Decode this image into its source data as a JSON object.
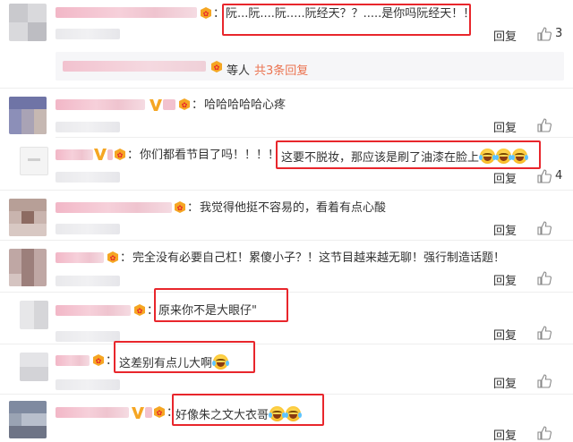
{
  "comments": [
    {
      "text": "阮...阮....阮.....阮经天？？.....是你吗阮经天！！",
      "reply": "回复",
      "likes": "3"
    },
    {
      "text": "哈哈哈哈哈心疼",
      "reply": "回复",
      "likes": ""
    },
    {
      "text_prefix": "你们都看节目了吗！！！！",
      "text_highlight": "这要不脱妆，那应该是刷了油漆在脸上",
      "reply": "回复",
      "likes": "4"
    },
    {
      "text": "我觉得他挺不容易的，看着有点心酸",
      "reply": "回复",
      "likes": ""
    },
    {
      "text": "完全没有必要自己杠！累傻小子？！这节目越来越无聊！强行制造话题！",
      "reply": "回复",
      "likes": ""
    },
    {
      "text": "原来你不是大眼仔\"",
      "reply": "回复",
      "likes": ""
    },
    {
      "text": "这差别有点儿大啊",
      "reply": "回复",
      "likes": ""
    },
    {
      "text": "好像朱之文大衣哥",
      "reply": "回复",
      "likes": ""
    }
  ],
  "summary": {
    "prefix": "等人",
    "link": "共3条回复"
  },
  "colon": "：",
  "colors": {
    "highlight_box": "#e8262c",
    "link": "#eb7350"
  }
}
